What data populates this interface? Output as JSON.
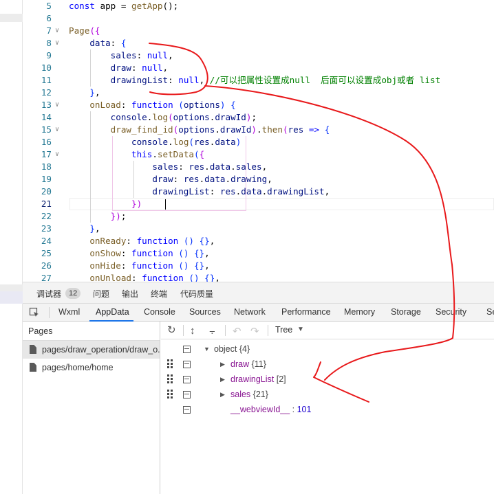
{
  "editor": {
    "lines": [
      {
        "num": "5",
        "tokens": [
          {
            "t": "const",
            "c": "kw"
          },
          {
            "t": " app = ",
            "c": ""
          },
          {
            "t": "getApp",
            "c": "fn"
          },
          {
            "t": "();",
            "c": ""
          }
        ]
      },
      {
        "num": "6",
        "tokens": []
      },
      {
        "num": "7",
        "fold": true,
        "tokens": [
          {
            "t": "Page",
            "c": "fn"
          },
          {
            "t": "({",
            "c": "br"
          }
        ]
      },
      {
        "num": "8",
        "fold": true,
        "tokens": [
          {
            "t": "    data",
            "c": "var"
          },
          {
            "t": ": ",
            "c": ""
          },
          {
            "t": "{",
            "c": "pn"
          }
        ]
      },
      {
        "num": "9",
        "tokens": [
          {
            "t": "        sales",
            "c": "var"
          },
          {
            "t": ": ",
            "c": ""
          },
          {
            "t": "null",
            "c": "nl"
          },
          {
            "t": ",",
            "c": ""
          }
        ]
      },
      {
        "num": "10",
        "tokens": [
          {
            "t": "        draw",
            "c": "var"
          },
          {
            "t": ": ",
            "c": ""
          },
          {
            "t": "null",
            "c": "nl"
          },
          {
            "t": ",",
            "c": ""
          }
        ]
      },
      {
        "num": "11",
        "tokens": [
          {
            "t": "        drawingList",
            "c": "var"
          },
          {
            "t": ": ",
            "c": ""
          },
          {
            "t": "null",
            "c": "nl"
          },
          {
            "t": ", ",
            "c": ""
          },
          {
            "t": "//可以把属性设置成null  后面可以设置成obj或者 list",
            "c": "cm"
          }
        ]
      },
      {
        "num": "12",
        "tokens": [
          {
            "t": "    ",
            "c": ""
          },
          {
            "t": "}",
            "c": "pn"
          },
          {
            "t": ",",
            "c": ""
          }
        ]
      },
      {
        "num": "13",
        "fold": true,
        "tokens": [
          {
            "t": "    onLoad",
            "c": "fn"
          },
          {
            "t": ": ",
            "c": ""
          },
          {
            "t": "function",
            "c": "kw"
          },
          {
            "t": " (",
            "c": "pn"
          },
          {
            "t": "options",
            "c": "var"
          },
          {
            "t": ") {",
            "c": "pn"
          }
        ]
      },
      {
        "num": "14",
        "tokens": [
          {
            "t": "        console",
            "c": "var"
          },
          {
            "t": ".",
            "c": ""
          },
          {
            "t": "log",
            "c": "fn"
          },
          {
            "t": "(",
            "c": "br"
          },
          {
            "t": "options",
            "c": "var"
          },
          {
            "t": ".",
            "c": ""
          },
          {
            "t": "drawId",
            "c": "var"
          },
          {
            "t": ")",
            "c": "br"
          },
          {
            "t": ";",
            "c": ""
          }
        ]
      },
      {
        "num": "15",
        "fold": true,
        "tokens": [
          {
            "t": "        draw_find_id",
            "c": "fn"
          },
          {
            "t": "(",
            "c": "br"
          },
          {
            "t": "options",
            "c": "var"
          },
          {
            "t": ".",
            "c": ""
          },
          {
            "t": "drawId",
            "c": "var"
          },
          {
            "t": ")",
            "c": "br"
          },
          {
            "t": ".",
            "c": ""
          },
          {
            "t": "then",
            "c": "fn"
          },
          {
            "t": "(",
            "c": "br"
          },
          {
            "t": "res",
            "c": "var"
          },
          {
            "t": " => ",
            "c": "kw"
          },
          {
            "t": "{",
            "c": "pn"
          }
        ]
      },
      {
        "num": "16",
        "tokens": [
          {
            "t": "            console",
            "c": "var"
          },
          {
            "t": ".",
            "c": ""
          },
          {
            "t": "log",
            "c": "fn"
          },
          {
            "t": "(",
            "c": "pn"
          },
          {
            "t": "res",
            "c": "var"
          },
          {
            "t": ".",
            "c": ""
          },
          {
            "t": "data",
            "c": "var"
          },
          {
            "t": ")",
            "c": "pn"
          }
        ]
      },
      {
        "num": "17",
        "fold": true,
        "tokens": [
          {
            "t": "            this",
            "c": "kw"
          },
          {
            "t": ".",
            "c": ""
          },
          {
            "t": "setData",
            "c": "fn"
          },
          {
            "t": "(",
            "c": "pn"
          },
          {
            "t": "{",
            "c": "br"
          }
        ]
      },
      {
        "num": "18",
        "tokens": [
          {
            "t": "                sales",
            "c": "var"
          },
          {
            "t": ": ",
            "c": ""
          },
          {
            "t": "res",
            "c": "var"
          },
          {
            "t": ".",
            "c": ""
          },
          {
            "t": "data",
            "c": "var"
          },
          {
            "t": ".",
            "c": ""
          },
          {
            "t": "sales",
            "c": "var"
          },
          {
            "t": ",",
            "c": ""
          }
        ]
      },
      {
        "num": "19",
        "tokens": [
          {
            "t": "                draw",
            "c": "var"
          },
          {
            "t": ": ",
            "c": ""
          },
          {
            "t": "res",
            "c": "var"
          },
          {
            "t": ".",
            "c": ""
          },
          {
            "t": "data",
            "c": "var"
          },
          {
            "t": ".",
            "c": ""
          },
          {
            "t": "drawing",
            "c": "var"
          },
          {
            "t": ",",
            "c": ""
          }
        ]
      },
      {
        "num": "20",
        "tokens": [
          {
            "t": "                drawingList",
            "c": "var"
          },
          {
            "t": ": ",
            "c": ""
          },
          {
            "t": "res",
            "c": "var"
          },
          {
            "t": ".",
            "c": ""
          },
          {
            "t": "data",
            "c": "var"
          },
          {
            "t": ".",
            "c": ""
          },
          {
            "t": "drawingList",
            "c": "var"
          },
          {
            "t": ",",
            "c": ""
          }
        ]
      },
      {
        "num": "21",
        "current": true,
        "tokens": [
          {
            "t": "            ",
            "c": ""
          },
          {
            "t": "})",
            "c": "br"
          }
        ]
      },
      {
        "num": "22",
        "tokens": [
          {
            "t": "        ",
            "c": ""
          },
          {
            "t": "})",
            "c": "br"
          },
          {
            "t": ";",
            "c": ""
          }
        ]
      },
      {
        "num": "23",
        "tokens": [
          {
            "t": "    ",
            "c": ""
          },
          {
            "t": "}",
            "c": "pn"
          },
          {
            "t": ",",
            "c": ""
          }
        ]
      },
      {
        "num": "24",
        "tokens": [
          {
            "t": "    onReady",
            "c": "fn"
          },
          {
            "t": ": ",
            "c": ""
          },
          {
            "t": "function",
            "c": "kw"
          },
          {
            "t": " () {}",
            "c": "pn"
          },
          {
            "t": ",",
            "c": ""
          }
        ]
      },
      {
        "num": "25",
        "tokens": [
          {
            "t": "    onShow",
            "c": "fn"
          },
          {
            "t": ": ",
            "c": ""
          },
          {
            "t": "function",
            "c": "kw"
          },
          {
            "t": " () {}",
            "c": "pn"
          },
          {
            "t": ",",
            "c": ""
          }
        ]
      },
      {
        "num": "26",
        "tokens": [
          {
            "t": "    onHide",
            "c": "fn"
          },
          {
            "t": ": ",
            "c": ""
          },
          {
            "t": "function",
            "c": "kw"
          },
          {
            "t": " () {}",
            "c": "pn"
          },
          {
            "t": ",",
            "c": ""
          }
        ]
      },
      {
        "num": "27",
        "tokens": [
          {
            "t": "    onUnload",
            "c": "fn"
          },
          {
            "t": ": ",
            "c": ""
          },
          {
            "t": "function",
            "c": "kw"
          },
          {
            "t": " () {}",
            "c": "pn"
          },
          {
            "t": ",",
            "c": ""
          }
        ]
      }
    ]
  },
  "devtools": {
    "top_tabs": {
      "debugger": "调试器",
      "badge": "12",
      "issues": "问题",
      "output": "输出",
      "terminal": "终端",
      "quality": "代码质量"
    },
    "panel_tabs": [
      "Wxml",
      "AppData",
      "Console",
      "Sources",
      "Network",
      "Performance",
      "Memory",
      "Storage",
      "Security",
      "Se"
    ],
    "active_panel": "AppData",
    "pages": {
      "header": "Pages",
      "items": [
        "pages/draw_operation/draw_o...",
        "pages/home/home"
      ]
    },
    "toolbar": {
      "view_mode": "Tree"
    },
    "tree": {
      "root": {
        "label": "object",
        "count": "{4}"
      },
      "items": [
        {
          "key": "draw",
          "value": "{11}"
        },
        {
          "key": "drawingList",
          "value": "[2]"
        },
        {
          "key": "sales",
          "value": "{21}"
        },
        {
          "key": "__webviewId__",
          "value": "101"
        }
      ]
    }
  },
  "colors": {
    "accent": "#1a73e8",
    "annotation": "#e8191b"
  }
}
